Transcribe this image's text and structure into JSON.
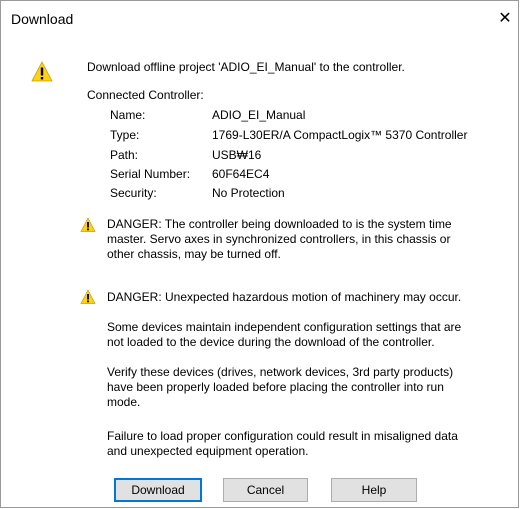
{
  "window": {
    "title": "Download",
    "close_glyph": "✕"
  },
  "header": {
    "message": "Download offline project 'ADIO_EI_Manual' to the controller."
  },
  "connected": {
    "heading": "Connected Controller:",
    "rows": [
      {
        "label": "Name:",
        "value": "ADIO_EI_Manual"
      },
      {
        "label": "Type:",
        "value": "1769-L30ER/A CompactLogix™ 5370 Controller"
      },
      {
        "label": "Path:",
        "value": "USB₩16"
      },
      {
        "label": "Serial Number:",
        "value": "60F64EC4"
      },
      {
        "label": "Security:",
        "value": "No Protection"
      }
    ]
  },
  "warnings": [
    {
      "lines": [
        "DANGER: The controller being downloaded to is the system time",
        "master.  Servo axes in synchronized controllers, in this chassis or",
        "other chassis, may be turned off."
      ]
    },
    {
      "lines": [
        "DANGER: Unexpected hazardous motion of machinery may occur."
      ]
    }
  ],
  "paragraphs": [
    {
      "lines": [
        "Some devices maintain independent configuration settings that are",
        "not loaded to the device during the download of the controller."
      ]
    },
    {
      "lines": [
        "Verify these devices (drives, network devices, 3rd party products)",
        "have been properly loaded before placing the controller into run",
        "mode."
      ]
    },
    {
      "lines": [
        "Failure to load proper configuration could result in misaligned data",
        "and unexpected equipment operation."
      ]
    }
  ],
  "buttons": {
    "download": "Download",
    "cancel": "Cancel",
    "help": "Help"
  },
  "icons": {
    "warning": "warning-icon",
    "close": "close-icon"
  },
  "colors": {
    "warning_yellow": "#fcd116",
    "default_border": "#0078d7",
    "button_bg": "#e1e1e1"
  }
}
